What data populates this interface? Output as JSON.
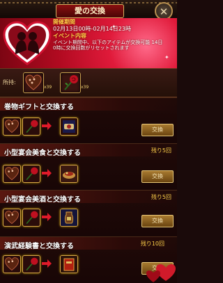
{
  "title": "愛の交換",
  "close_label": "✕",
  "banner": {
    "period_heading": "開催期間",
    "period": "02月13日00時-02月14日23時",
    "content_heading": "イベント内容",
    "description_1": "イベント期間中、以下のアイテムが交換可能 14日",
    "description_2": "0時に交換回数がリセットされます"
  },
  "owned": {
    "label": "所持:",
    "items": [
      {
        "icon": "heart-chocolate-icon",
        "qty": "x39"
      },
      {
        "icon": "rose-icon",
        "qty": "x39"
      }
    ]
  },
  "sections": [
    {
      "title": "巻物ギフトと交換する",
      "remaining": "",
      "button": "交換",
      "reward_icon": "scroll-gift-icon"
    },
    {
      "title": "小型宴会美食と交換する",
      "remaining": "残り5回",
      "button": "交換",
      "reward_icon": "banquet-food-icon"
    },
    {
      "title": "小型宴会美酒と交換する",
      "remaining": "残り5回",
      "button": "交換",
      "reward_icon": "banquet-wine-icon"
    },
    {
      "title": "演武経験書と交換する",
      "remaining": "残り10回",
      "button": "交換",
      "reward_icon": "experience-book-icon"
    }
  ],
  "colors": {
    "accent": "#d8a848",
    "banner": "#e01a3a",
    "text_highlight": "#ffd24a"
  }
}
